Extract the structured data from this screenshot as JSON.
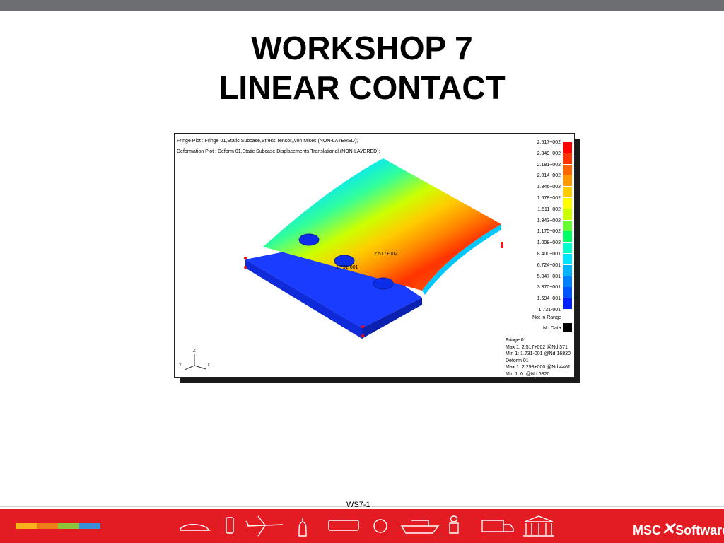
{
  "slide": {
    "title_line1": "WORKSHOP 7",
    "title_line2": "LINEAR CONTACT",
    "page_label": "WS7-1"
  },
  "plot": {
    "fringe_header": "Fringe Plot : Fringe 01,Static Subcase,Stress Tensor,,von Mises,(NON-LAYERED);",
    "deform_header": "Deformation Plot : Deform 01,Static Subcase,Displacements,Translational,(NON-LAYERED);",
    "max_marker": "2.517+002",
    "min_marker": "1.731-001",
    "legend": [
      {
        "label": "2.517+002",
        "color": "#ff0000"
      },
      {
        "label": "2.349+002",
        "color": "#ff3300"
      },
      {
        "label": "2.181+002",
        "color": "#ff6600"
      },
      {
        "label": "2.014+002",
        "color": "#ff9900"
      },
      {
        "label": "1.846+002",
        "color": "#ffcc00"
      },
      {
        "label": "1.678+002",
        "color": "#ffff00"
      },
      {
        "label": "1.511+002",
        "color": "#ccff00"
      },
      {
        "label": "1.343+002",
        "color": "#66ff33"
      },
      {
        "label": "1.175+002",
        "color": "#00ff66"
      },
      {
        "label": "1.008+002",
        "color": "#00ffcc"
      },
      {
        "label": "8.400+001",
        "color": "#00e5ff"
      },
      {
        "label": "6.724+001",
        "color": "#00b3ff"
      },
      {
        "label": "5.047+001",
        "color": "#0080ff"
      },
      {
        "label": "3.370+001",
        "color": "#0055ff"
      },
      {
        "label": "1.694+001",
        "color": "#0022ff"
      },
      {
        "label": "1.731-001",
        "color": "#0000e0"
      }
    ],
    "not_in_range": "Not in Range",
    "no_data": "No Data",
    "summary": [
      "Fringe 01",
      "Max 1: 2.517+002 @Nd 371",
      "Min 1: 1.731-001 @Nd 16820",
      "Deform 01",
      "Max 1: 2.298+000 @Nd 4461",
      "Min 1:    0. @Nd 6820"
    ],
    "axis_labels": {
      "x": "X",
      "y": "Y",
      "z": "Z"
    }
  },
  "footer": {
    "brand_prefix": "MSC",
    "brand_suffix": "Software",
    "stripe_colors": [
      "#f7b21b",
      "#ef7d1a",
      "#8cc63f",
      "#3a8fd9"
    ],
    "icons": [
      "car-icon",
      "phone-icon",
      "airplane-icon",
      "bottle-icon",
      "bus-icon",
      "gear-icon",
      "ship-icon",
      "astronaut-icon",
      "truck-icon",
      "building-icon"
    ]
  }
}
